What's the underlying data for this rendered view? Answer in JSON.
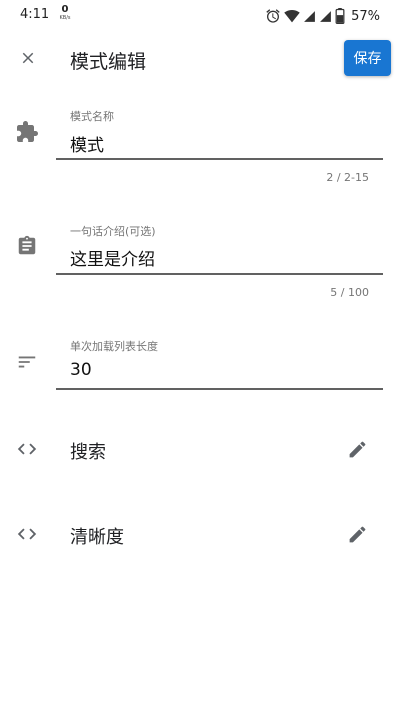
{
  "status_bar": {
    "time": "4:11",
    "net_speed": "0",
    "net_unit": "KB/s",
    "battery_percent": "57%",
    "icons": [
      "alarm-icon",
      "wifi-icon",
      "signal-icon",
      "signal-icon",
      "battery-icon"
    ]
  },
  "toolbar": {
    "close_icon": "close-icon",
    "title": "模式编辑",
    "save_label": "保存",
    "accent_color": "#1976d2"
  },
  "fields": {
    "name": {
      "icon": "puzzle-icon",
      "label": "模式名称",
      "value": "模式",
      "counter": "2 / 2-15"
    },
    "intro": {
      "icon": "clipboard-icon",
      "label": "一句话介绍(可选)",
      "value": "这里是介绍",
      "counter": "5 / 100"
    },
    "list_length": {
      "icon": "sort-icon",
      "label": "单次加载列表长度",
      "value": "30"
    }
  },
  "rows": [
    {
      "icon": "code-icon",
      "label": "搜索",
      "action_icon": "pencil-icon"
    },
    {
      "icon": "code-icon",
      "label": "清晰度",
      "action_icon": "pencil-icon"
    }
  ]
}
